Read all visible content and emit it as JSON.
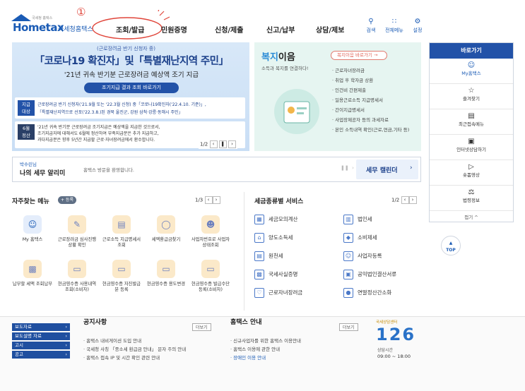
{
  "header": {
    "logo_main": "Hometax",
    "logo_sub": "국세청홈택스",
    "logo_tiny": "국세청 홈택스",
    "annotation_number": "①",
    "nav": [
      "조회/발급",
      "민원증명",
      "신청/제출",
      "신고/납부",
      "상담/제보"
    ],
    "tools": [
      {
        "icon": "search-icon",
        "label": "검색"
      },
      {
        "icon": "grid-icon",
        "label": "전체메뉴"
      },
      {
        "icon": "gear-icon",
        "label": "설정"
      }
    ]
  },
  "banner": {
    "tag": "(근로장려금 반기 신청자 중)",
    "headline": "「코로나19 확진자」및「특별재난지역 주민」",
    "subhead": "'21년 귀속 반기분 근로장려금 예상액 조기 지급",
    "button": "조기지급 결과 조회 바로가기",
    "row1_label": "지급\n대상",
    "row1_line1": "근로장려금 반기 신청자('21.9월 또는 '22.3월 신청) 중「코로나19확진자('22.4.10. 기준)」,",
    "row1_line2": "「특별재난지역으로 선포('22.3.8.)된 경북 울진군, 강원 삼척·강릉·동해시 주민」",
    "row2_label": "6월\n정산",
    "row2_line1": "'21년 귀속 반기분 근로장려금 조기지급은 예상액을 지급한 것으로서,",
    "row2_line2": "조기지급자에 대해서도 6월에 정산하여 부족지급분은 추가 지급하고,",
    "row2_line3": "과다지급분은 향후 5년간 지급할 근로·자녀장려금에서 환수합니다.",
    "pager": "1/2"
  },
  "welfare": {
    "title_a": "복지",
    "title_b": "이음",
    "desc": "소득과 복지를 연결하다!",
    "link": "복지이음 바로가기",
    "items": [
      "근로자녀장려금",
      "취업 후 학자금 상환",
      "인건비 간편제출",
      "일용근로소득 지급명세서",
      "간이지급명세서",
      "사업장제공자 등의 과세자료",
      "본인 소득내역 확인(근로,연금,기타 등)"
    ]
  },
  "quick": {
    "title": "바로가기",
    "items": [
      {
        "icon": "person-icon",
        "label": "My홈택스"
      },
      {
        "icon": "star-icon",
        "label": "즐겨찾기"
      },
      {
        "icon": "recent-icon",
        "label": "최근접속메뉴"
      },
      {
        "icon": "monitor-icon",
        "label": "인터넷상담하기"
      },
      {
        "icon": "play-icon",
        "label": "숏폼영상"
      },
      {
        "icon": "law-icon",
        "label": "법령정보"
      }
    ],
    "fold": "접기 ^",
    "top": "TOP"
  },
  "welcome": {
    "user": "박수린님",
    "title": "나의 세무 알리미",
    "message": "홈택스 방문을 환영합니다.",
    "calendar": "세무 캘린더"
  },
  "favorites": {
    "title": "자주찾는 메뉴",
    "add": "+ 등록",
    "pager": "1/3",
    "items": [
      {
        "icon": "person-icon",
        "label": "My 홈택스",
        "blue": true
      },
      {
        "icon": "document-icon",
        "label": "근로장려금 심사진행상황 확인",
        "blue": false
      },
      {
        "icon": "receipt-icon",
        "label": "근로소득 지급명세서 조회",
        "blue": false
      },
      {
        "icon": "coin-icon",
        "label": "세액환급금찾기",
        "blue": false
      },
      {
        "icon": "people-icon",
        "label": "사업자번호로 사업자상태조회",
        "blue": false
      },
      {
        "icon": "wallet-icon",
        "label": "납부할 세액 조회납부",
        "blue": false
      },
      {
        "icon": "card-icon",
        "label": "현금영수증 사용내역조회(소비자)",
        "blue": false
      },
      {
        "icon": "card-icon",
        "label": "현금영수증 자진발급분 등록",
        "blue": false
      },
      {
        "icon": "card-icon",
        "label": "현금영수증 용도변경",
        "blue": false
      },
      {
        "icon": "card-icon",
        "label": "현금영수증 발급수단 등록(소비자)",
        "blue": false
      }
    ]
  },
  "taxservice": {
    "title": "세금종류별 서비스",
    "pager": "1/2",
    "items": [
      {
        "icon": "calc-icon",
        "label": "세금모의계산"
      },
      {
        "icon": "corp-icon",
        "label": "법인세"
      },
      {
        "icon": "house-icon",
        "label": "양도소득세"
      },
      {
        "icon": "diamond-icon",
        "label": "소비제세"
      },
      {
        "icon": "doc-icon",
        "label": "원천세"
      },
      {
        "icon": "user-icon",
        "label": "사업자등록"
      },
      {
        "icon": "cert-icon",
        "label": "국세사실증명"
      },
      {
        "icon": "sheet-icon",
        "label": "공익법인결산서류"
      },
      {
        "icon": "heart-icon",
        "label": "근로자녀장려금"
      },
      {
        "icon": "coins-icon",
        "label": "연말정산간소화"
      }
    ]
  },
  "footer": {
    "left_links": [
      "보도자료",
      "보도설명 자료",
      "고시",
      "공고"
    ],
    "notice_title": "공지사항",
    "notice_more": "더보기",
    "notices": [
      "홈택스 내비게이션 도입 안내",
      "국세청 사칭 「종소세 환급금 안내」 문자 주의 안내",
      "홈택스 접속 IP 및 시간 확인 관련 안내"
    ],
    "guide_title": "홈택스 안내",
    "guide_more": "더보기",
    "guides": [
      "신규사업자를 위한 홈택스 이용안내",
      "홈택스 이용에 관한 안내",
      "장애인 이용 안내"
    ],
    "center_label": "국세상담센터",
    "center_number": "126",
    "hours_label": "상담시간",
    "hours": "09:00 ~ 18:00"
  }
}
